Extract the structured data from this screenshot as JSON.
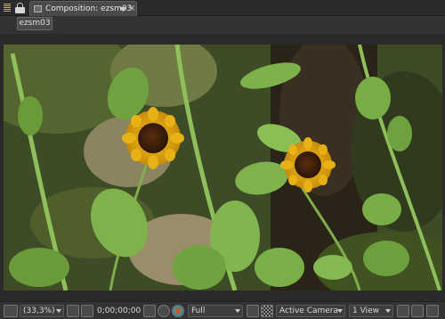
{
  "tab": {
    "title": "Composition: ezsm03",
    "close_symbol": "×"
  },
  "subbar": {
    "comp_button_label": "ezsm03"
  },
  "toolbar": {
    "zoom": "(33,3%)",
    "timecode": "0;00;00;00",
    "resolution": "Full",
    "camera": "Active Camera",
    "view_layout": "1 View"
  },
  "colors": {
    "panel_bg": "#3a3a3a",
    "tab_bg": "#4a4a4a",
    "viewer_bg": "#2a2a2a"
  }
}
